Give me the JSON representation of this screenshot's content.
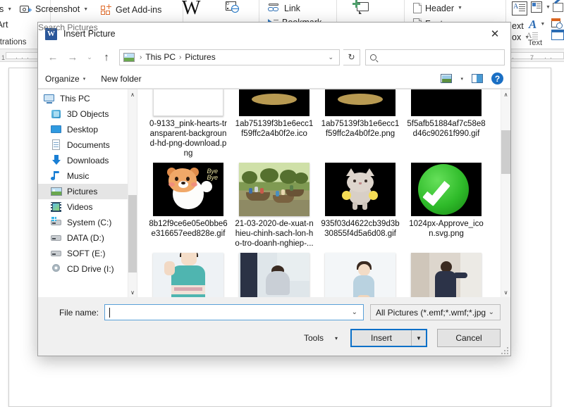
{
  "word": {
    "ribbon_items": [
      {
        "label": "es",
        "icon": "shapes-icon",
        "caret": true
      },
      {
        "label": "Screenshot",
        "icon": "screenshot-icon",
        "caret": true
      },
      {
        "label": "tArt",
        "icon": "smartart-icon",
        "caret": false
      },
      {
        "label": "t",
        "icon": "chart-icon",
        "caret": false
      },
      {
        "label": "Get Add-ins",
        "icon": "get-addins-icon",
        "caret": false
      },
      {
        "label": "W",
        "icon": "wikipedia-icon",
        "caret": false
      },
      {
        "label": "Link",
        "icon": "link-icon",
        "caret": false
      },
      {
        "label": "Bookmark",
        "icon": "bookmark-icon",
        "caret": false
      },
      {
        "label": "Header",
        "icon": "header-icon",
        "caret": true
      },
      {
        "label": "Footer",
        "icon": "footer-icon",
        "caret": true
      },
      {
        "label": "ext",
        "icon": "text-box-icon",
        "caret": false
      },
      {
        "label": "ox",
        "icon": "drop-cap-icon",
        "caret": true
      }
    ],
    "group_labels": [
      "strations",
      "Text"
    ],
    "ruler_tick": "7",
    "ruler_tick_left": "1"
  },
  "dialog": {
    "title": "Insert Picture",
    "close_label": "✕",
    "nav": {
      "back_label": "←",
      "forward_label": "→",
      "recent_label": "⌄",
      "up_label": "↑",
      "refresh_label": "↻",
      "address_caret": "⌄",
      "breadcrumbs": [
        "This PC",
        "Pictures"
      ],
      "separator": "›"
    },
    "search": {
      "placeholder": "Search Pictures"
    },
    "toolbar": {
      "organize_label": "Organize",
      "new_folder_label": "New folder",
      "caret": "▾",
      "view_caret": "▾",
      "help_label": "?"
    },
    "sidebar": {
      "items": [
        {
          "label": "This PC",
          "icon": "this-pc-icon",
          "level": 0,
          "selected": false
        },
        {
          "label": "3D Objects",
          "icon": "3d-objects-icon",
          "level": 1,
          "selected": false
        },
        {
          "label": "Desktop",
          "icon": "desktop-icon",
          "level": 1,
          "selected": false
        },
        {
          "label": "Documents",
          "icon": "documents-icon",
          "level": 1,
          "selected": false
        },
        {
          "label": "Downloads",
          "icon": "downloads-icon",
          "level": 1,
          "selected": false
        },
        {
          "label": "Music",
          "icon": "music-icon",
          "level": 1,
          "selected": false
        },
        {
          "label": "Pictures",
          "icon": "pictures-icon",
          "level": 1,
          "selected": true
        },
        {
          "label": "Videos",
          "icon": "videos-icon",
          "level": 1,
          "selected": false
        },
        {
          "label": "System (C:)",
          "icon": "system-drive-icon",
          "level": 1,
          "selected": false
        },
        {
          "label": "DATA (D:)",
          "icon": "drive-icon",
          "level": 1,
          "selected": false
        },
        {
          "label": "SOFT (E:)",
          "icon": "drive-icon",
          "level": 1,
          "selected": false
        },
        {
          "label": "CD Drive (I:)",
          "icon": "cd-drive-icon",
          "level": 1,
          "selected": false
        }
      ],
      "scroll_up": "∧",
      "scroll_down": "∨"
    },
    "files": [
      {
        "name": "0-9133_pink-hearts-transparent-background-hd-png-download.png",
        "thumb": "cutoff-white"
      },
      {
        "name": "1ab75139f3b1e6ecc1f59ffc2a4b0f2e.ico",
        "thumb": "cutoff-black"
      },
      {
        "name": "1ab75139f3b1e6ecc1f59ffc2a4b0f2e.png",
        "thumb": "cutoff-black"
      },
      {
        "name": "5f5afb51884af7c58e8d46c90261f990.gif",
        "thumb": "cutoff-black"
      },
      {
        "name": "8b12f9ce6e05e0bbe6e316657eed828e.gif",
        "thumb": "dog-gif"
      },
      {
        "name": "21-03-2020-de-xuat-nhieu-chinh-sach-lon-ho-tro-doanh-nghiep-...",
        "thumb": "boat-photo"
      },
      {
        "name": "935f03d4622cb39d3b30855f4d5a6d08.gif",
        "thumb": "cat-gif"
      },
      {
        "name": "1024px-Approve_icon.svg.png",
        "thumb": "approve-check"
      },
      {
        "name": "",
        "thumb": "kimono-photo"
      },
      {
        "name": "",
        "thumb": "bow-photo"
      },
      {
        "name": "",
        "thumb": "standing-photo"
      },
      {
        "name": "",
        "thumb": "doorway-photo"
      }
    ],
    "footer": {
      "filename_label": "File name:",
      "filename_value": "",
      "filename_caret": "⌄",
      "filter_value": "All Pictures (*.emf;*.wmf;*.jpg;*",
      "filter_caret": "⌄",
      "tools_label": "Tools",
      "tools_caret": "▾",
      "insert_label": "Insert",
      "insert_caret": "▼",
      "cancel_label": "Cancel"
    }
  },
  "colors": {
    "accent": "#0a70c8",
    "word_blue": "#2b579a",
    "selection": "#e5e5e5",
    "help_blue": "#1a6fc4"
  }
}
